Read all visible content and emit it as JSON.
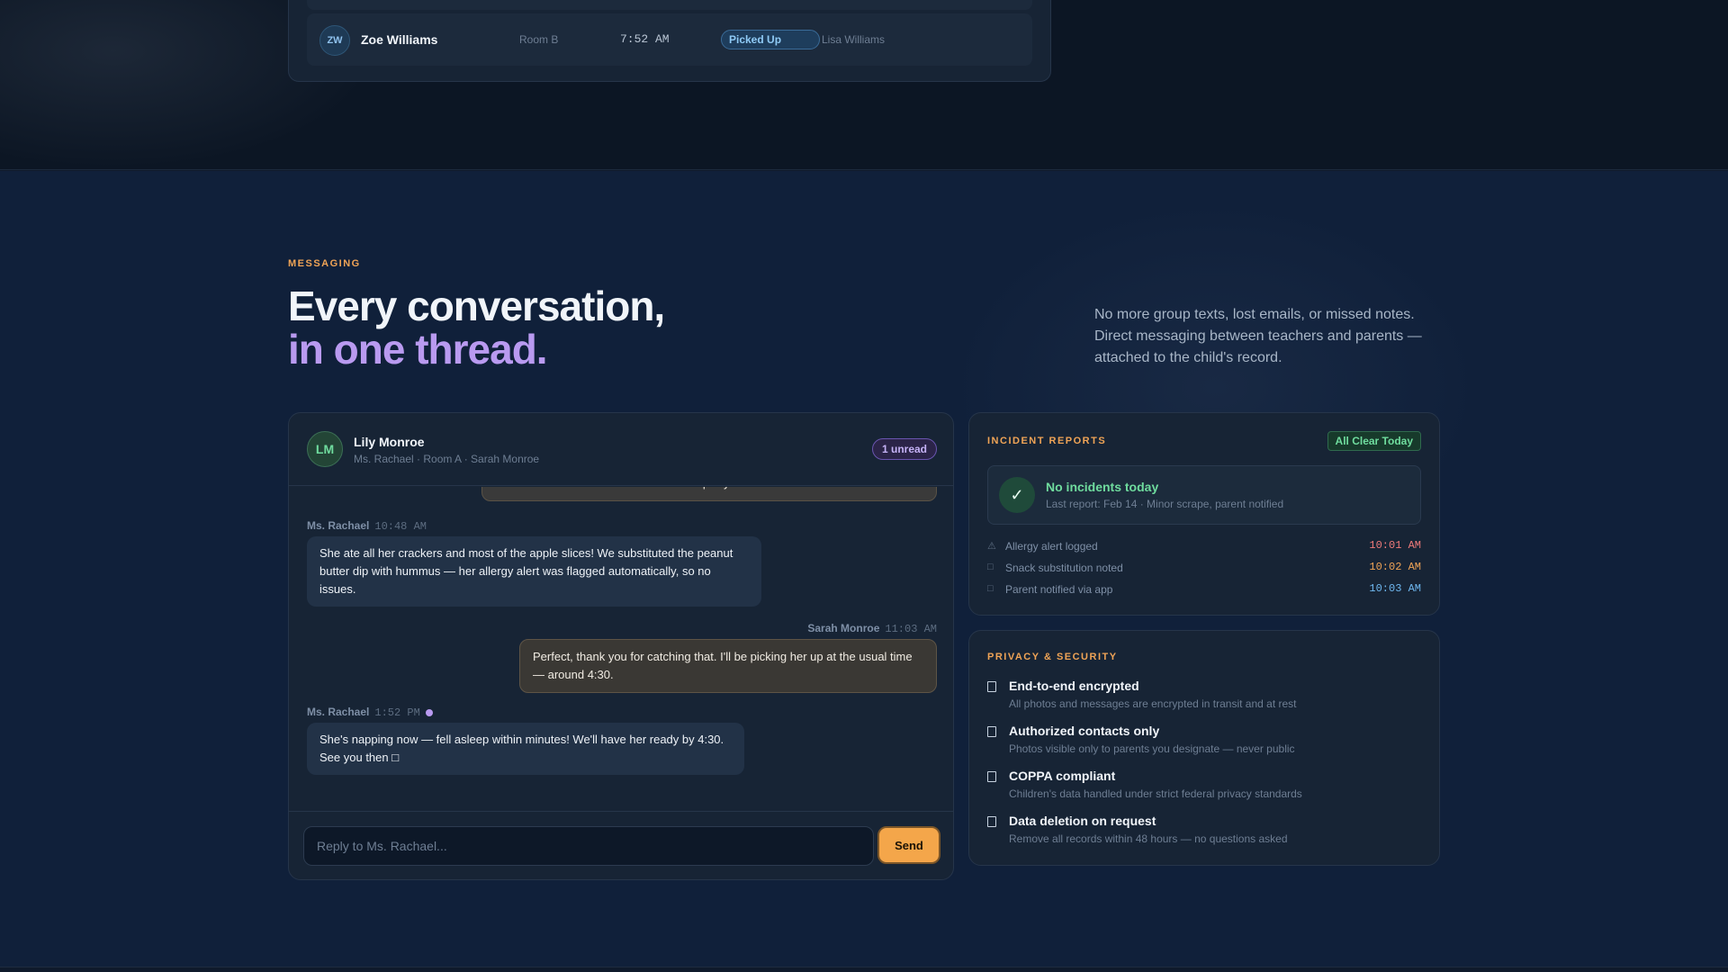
{
  "attendance": {
    "row": {
      "initials": "ZW",
      "name": "Zoe Williams",
      "room": "Room B",
      "time": "7:52 AM",
      "status": "Picked Up",
      "guardian": "Lisa Williams"
    }
  },
  "messaging": {
    "eyebrow": "MESSAGING",
    "headline_line1": "Every conversation,",
    "headline_line2": "in one thread.",
    "intro": "No more group texts, lost emails, or missed notes. Direct messaging between teachers and parents — attached to the child's record."
  },
  "chat": {
    "avatar_initials": "LM",
    "child_name": "Lily Monroe",
    "subtitle": "Ms. Rachael · Room A · Sarah Monroe",
    "unread": "1 unread",
    "cut_message": "did she eat her snack? She's been a bit picky this week!",
    "messages": [
      {
        "sender": "Ms. Rachael",
        "time": "10:48 AM",
        "text": "She ate all her crackers and most of the apple slices! We substituted the peanut butter dip with hummus — her allergy alert was flagged automatically, so no issues."
      },
      {
        "sender": "Sarah Monroe",
        "time": "11:03 AM",
        "text": "Perfect, thank you for catching that. I'll be picking her up at the usual time — around 4:30."
      },
      {
        "sender": "Ms. Rachael",
        "time": "1:52 PM",
        "text": "She's napping now — fell asleep within minutes! We'll have her ready by 4:30. See you then □"
      }
    ],
    "reply_placeholder": "Reply to Ms. Rachael...",
    "send_label": "Send"
  },
  "incidents": {
    "title": "INCIDENT REPORTS",
    "badge": "All Clear Today",
    "check_glyph": "✓",
    "summary_title": "No incidents today",
    "summary_sub": "Last report: Feb 14 · Minor scrape, parent notified",
    "log": [
      {
        "icon": "⚠",
        "label": "Allergy alert logged",
        "time": "10:01 AM",
        "color": "#f07a7a"
      },
      {
        "icon": "□",
        "label": "Snack substitution noted",
        "time": "10:02 AM",
        "color": "#f0a456"
      },
      {
        "icon": "□",
        "label": "Parent notified via app",
        "time": "10:03 AM",
        "color": "#6fb8f0"
      }
    ]
  },
  "privacy": {
    "title": "PRIVACY & SECURITY",
    "items": [
      {
        "title": "End-to-end encrypted",
        "desc": "All photos and messages are encrypted in transit and at rest"
      },
      {
        "title": "Authorized contacts only",
        "desc": "Photos visible only to parents you designate — never public"
      },
      {
        "title": "COPPA compliant",
        "desc": "Children's data handled under strict federal privacy standards"
      },
      {
        "title": "Data deletion on request",
        "desc": "Remove all records within 48 hours — no questions asked"
      }
    ]
  },
  "colors": {
    "accent_orange": "#f0a456",
    "accent_purple": "#b99af0",
    "accent_green": "#6fdc9e",
    "background": "#10203a"
  }
}
